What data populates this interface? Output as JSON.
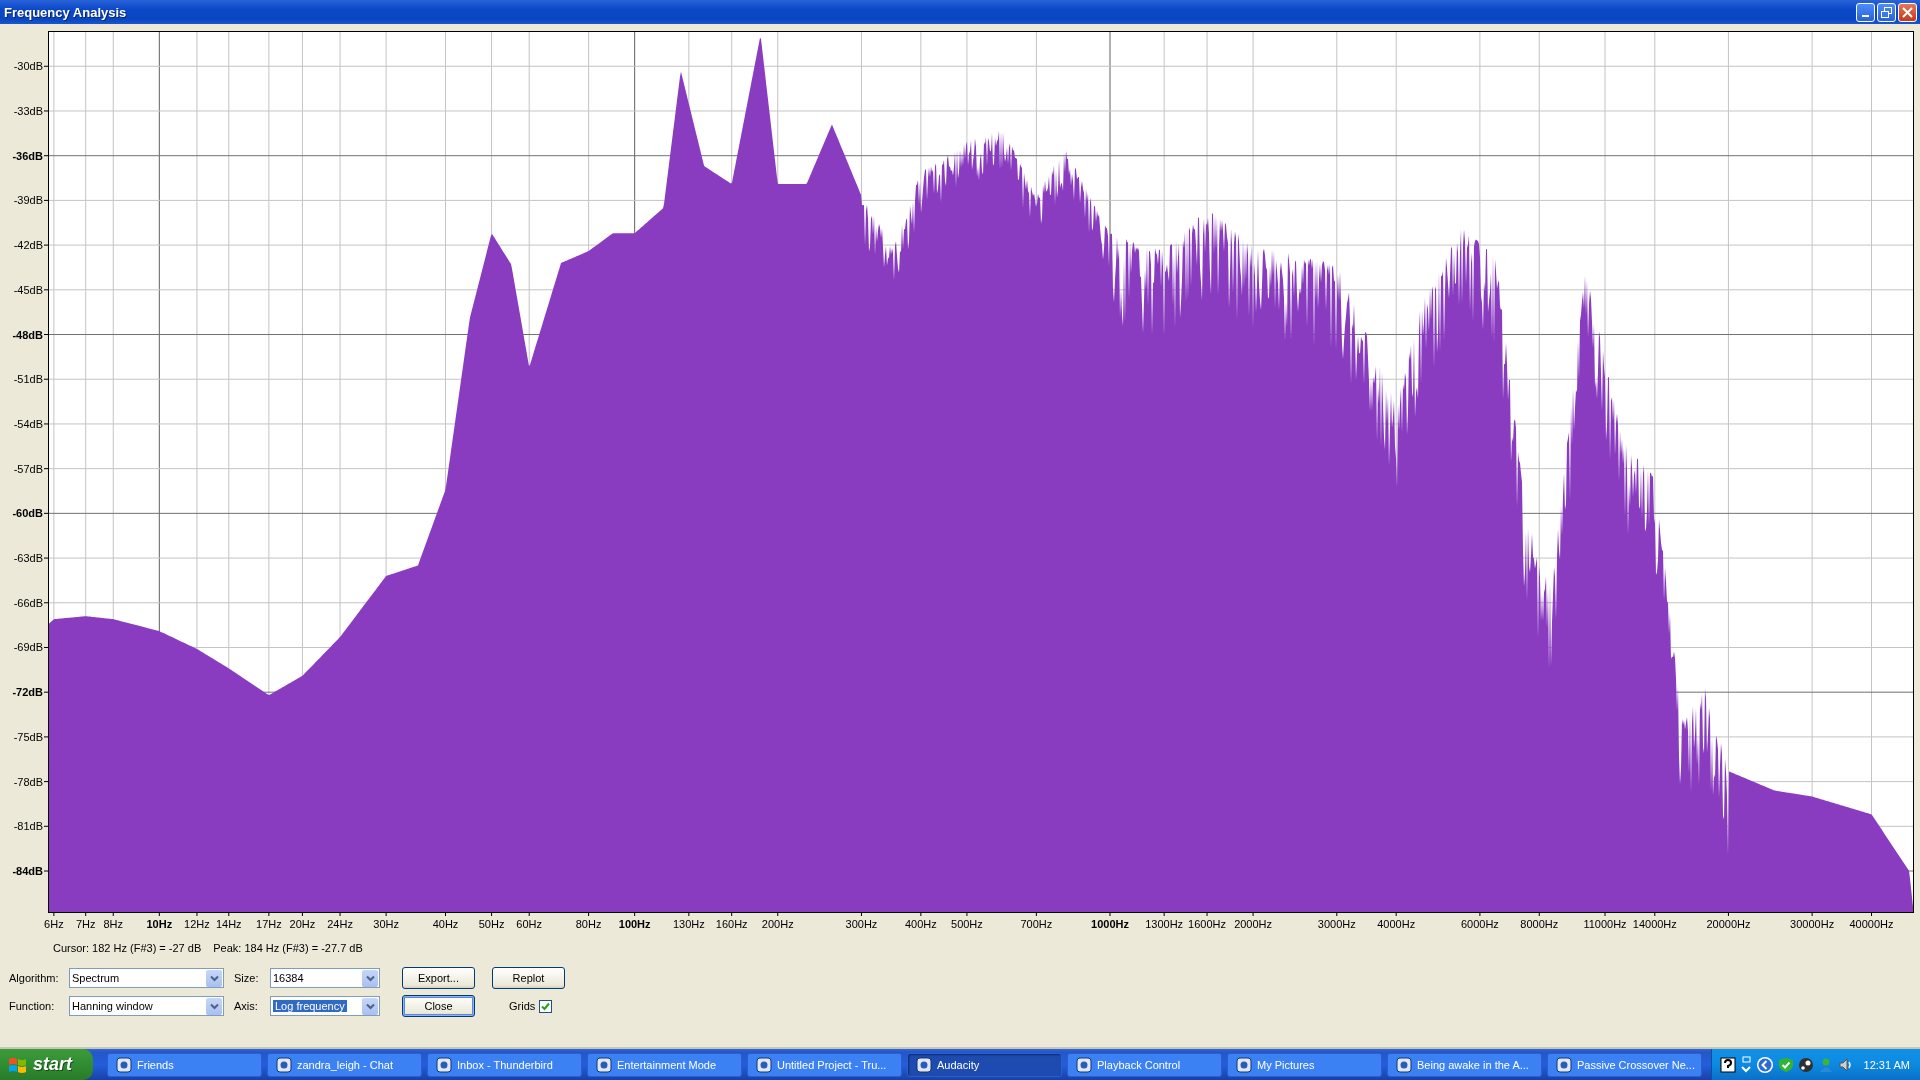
{
  "window": {
    "title": "Frequency Analysis"
  },
  "spectrum": {
    "y_labels": [
      {
        "label": "-30dB",
        "major": false
      },
      {
        "label": "-33dB",
        "major": false
      },
      {
        "label": "-36dB",
        "major": true
      },
      {
        "label": "-39dB",
        "major": false
      },
      {
        "label": "-42dB",
        "major": false
      },
      {
        "label": "-45dB",
        "major": false
      },
      {
        "label": "-48dB",
        "major": true
      },
      {
        "label": "-51dB",
        "major": false
      },
      {
        "label": "-54dB",
        "major": false
      },
      {
        "label": "-57dB",
        "major": false
      },
      {
        "label": "-60dB",
        "major": true
      },
      {
        "label": "-63dB",
        "major": false
      },
      {
        "label": "-66dB",
        "major": false
      },
      {
        "label": "-69dB",
        "major": false
      },
      {
        "label": "-72dB",
        "major": true
      },
      {
        "label": "-75dB",
        "major": false
      },
      {
        "label": "-78dB",
        "major": false
      },
      {
        "label": "-81dB",
        "major": false
      },
      {
        "label": "-84dB",
        "major": true
      }
    ],
    "x_labels": [
      {
        "label": "6Hz",
        "major": false
      },
      {
        "label": "7Hz",
        "major": false
      },
      {
        "label": "8Hz",
        "major": false
      },
      {
        "label": "10Hz",
        "major": true
      },
      {
        "label": "12Hz",
        "major": false
      },
      {
        "label": "14Hz",
        "major": false
      },
      {
        "label": "17Hz",
        "major": false
      },
      {
        "label": "20Hz",
        "major": false
      },
      {
        "label": "24Hz",
        "major": false
      },
      {
        "label": "30Hz",
        "major": false
      },
      {
        "label": "40Hz",
        "major": false
      },
      {
        "label": "50Hz",
        "major": false
      },
      {
        "label": "60Hz",
        "major": false
      },
      {
        "label": "80Hz",
        "major": false
      },
      {
        "label": "100Hz",
        "major": true
      },
      {
        "label": "130Hz",
        "major": false
      },
      {
        "label": "160Hz",
        "major": false
      },
      {
        "label": "200Hz",
        "major": false
      },
      {
        "label": "300Hz",
        "major": false
      },
      {
        "label": "400Hz",
        "major": false
      },
      {
        "label": "500Hz",
        "major": false
      },
      {
        "label": "700Hz",
        "major": false
      },
      {
        "label": "1000Hz",
        "major": true
      },
      {
        "label": "1300Hz",
        "major": false
      },
      {
        "label": "1600Hz",
        "major": false
      },
      {
        "label": "2000Hz",
        "major": false
      },
      {
        "label": "3000Hz",
        "major": false
      },
      {
        "label": "4000Hz",
        "major": false
      },
      {
        "label": "6000Hz",
        "major": false
      },
      {
        "label": "8000Hz",
        "major": false
      },
      {
        "label": "11000Hz",
        "major": false
      },
      {
        "label": "14000Hz",
        "major": false
      },
      {
        "label": "20000Hz",
        "major": false
      },
      {
        "label": "30000Hz",
        "major": false
      },
      {
        "label": "40000Hz",
        "major": false
      }
    ]
  },
  "readout": {
    "cursor": "Cursor: 182 Hz (F#3) = -27 dB",
    "peak": "Peak: 184 Hz (F#3) = -27.7 dB"
  },
  "controls": {
    "rows": [
      {
        "combos": [
          {
            "label": "Algorithm:",
            "value": "Spectrum",
            "focused": false
          },
          {
            "label": "Size:",
            "value": "16384",
            "focused": false
          }
        ],
        "button": {
          "label": "Export...",
          "default": false
        },
        "extra": {
          "kind": "button",
          "label": "Replot",
          "default": false
        }
      },
      {
        "combos": [
          {
            "label": "Function:",
            "value": "Hanning window",
            "focused": false
          },
          {
            "label": "Axis:",
            "value": "Log frequency",
            "focused": true
          }
        ],
        "button": {
          "label": "Close",
          "default": true
        },
        "extra": {
          "kind": "checkbox",
          "label": "Grids",
          "checked": true
        }
      }
    ]
  },
  "taskbar": {
    "start": "start",
    "tasks": [
      {
        "label": "Friends",
        "active": false
      },
      {
        "label": "zandra_leigh - Chat",
        "active": false
      },
      {
        "label": "Inbox - Thunderbird",
        "active": false
      },
      {
        "label": "Entertainment Mode",
        "active": false
      },
      {
        "label": "Untitled Project - Tru...",
        "active": false
      },
      {
        "label": "Audacity",
        "active": true
      },
      {
        "label": "Playback Control",
        "active": false
      },
      {
        "label": "My Pictures",
        "active": false
      },
      {
        "label": "Being awake in the A...",
        "active": false
      },
      {
        "label": "Passive Crossover Ne...",
        "active": false
      }
    ],
    "clock": "12:31 AM"
  }
}
